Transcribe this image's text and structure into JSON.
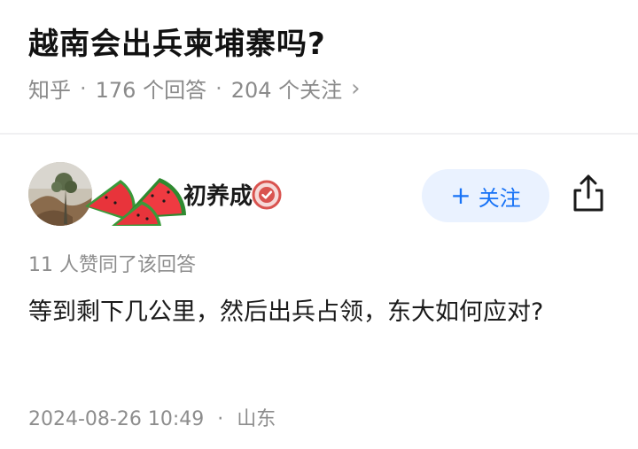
{
  "question": {
    "title": "越南会出兵柬埔寨吗?",
    "source": "知乎",
    "answer_count": "176 个回答",
    "follow_count": "204 个关注",
    "separator": "·"
  },
  "author": {
    "name": "初养成",
    "follow_button_label": "关注",
    "follow_button_icon": "plus-icon"
  },
  "answer": {
    "likes_text": "11 人赞同了该回答",
    "content": "等到剩下几公里，然后出兵占领，东大如何应对?",
    "date": "2024-08-26 10:49",
    "location": "山东"
  },
  "colors": {
    "accent": "#1772f6",
    "follow_bg": "#eaf2ff",
    "muted_text": "#8d8d8d",
    "verify_red": "#d9534f"
  }
}
